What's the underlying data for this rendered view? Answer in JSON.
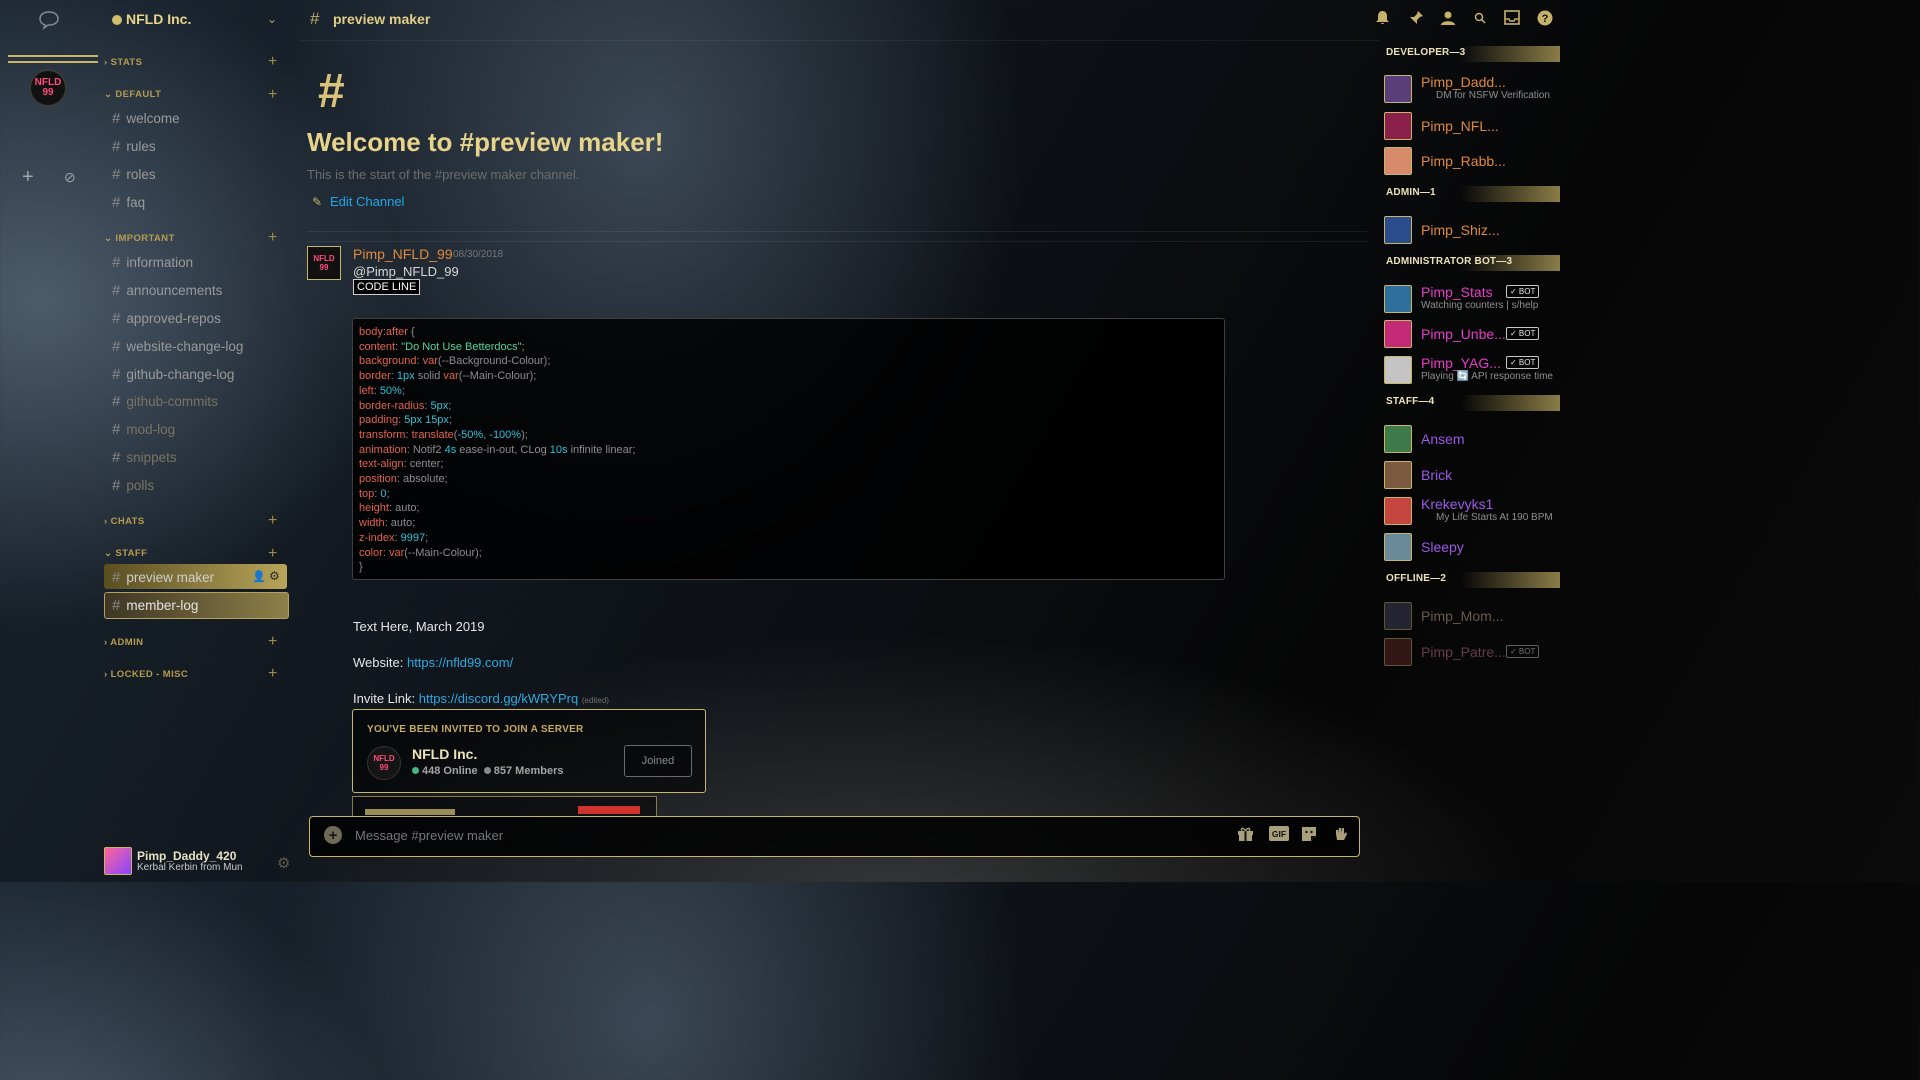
{
  "rail": {
    "home_icon": "chat-bubble-icon",
    "server_abbrev": "NFLD 99",
    "add_glyph": "+",
    "explore_glyph": "⊘"
  },
  "server": {
    "name": "NFLD Inc."
  },
  "sidebar": {
    "categories": [
      "STATS",
      "DEFAULT",
      "IMPORTANT",
      "CHATS",
      "STAFF",
      "ADMIN",
      "LOCKED - MISC"
    ],
    "default_channels": [
      "welcome",
      "rules",
      "roles",
      "faq"
    ],
    "important_channels": [
      "information",
      "announcements",
      "approved-repos",
      "website-change-log",
      "github-change-log",
      "github-commits",
      "mod-log",
      "snippets",
      "polls"
    ],
    "staff_channels": [
      "preview maker",
      "member-log"
    ]
  },
  "user_panel": {
    "username": "Pimp_Daddy_420",
    "status": "Kerbal Kerbin from Mun"
  },
  "header": {
    "channel": "preview maker"
  },
  "welcome": {
    "hash": "#",
    "title": "Welcome to #preview maker!",
    "subtitle": "This is the start of the #preview maker channel.",
    "edit_label": "Edit Channel"
  },
  "message": {
    "author": "Pimp_NFLD_99",
    "timestamp": "08/30/2018",
    "mention": "@Pimp_NFLD_99",
    "code_inline": "CODE LINE",
    "text_here": "Text Here, March 2019",
    "website_label": "Website:",
    "website_url": "https://nfld99.com/",
    "invite_label": "Invite Link:",
    "invite_url": "https://discord.gg/kWRYPrq",
    "edited": "(edited)"
  },
  "codeblock": [
    [
      [
        "kw",
        "body"
      ],
      [
        "plain",
        ":"
      ],
      [
        "kw",
        "after"
      ],
      [
        "brace",
        " {"
      ]
    ],
    [
      [
        "kw",
        "content"
      ],
      [
        "plain",
        ": "
      ],
      [
        "str",
        "\"Do Not Use Betterdocs\""
      ],
      [
        "plain",
        ";"
      ]
    ],
    [
      [
        "kw",
        "background"
      ],
      [
        "plain",
        ": "
      ],
      [
        "kw",
        "var"
      ],
      [
        "plain",
        "(--Background-Colour);"
      ]
    ],
    [
      [
        "kw",
        "border"
      ],
      [
        "plain",
        ": "
      ],
      [
        "num",
        "1px"
      ],
      [
        "plain",
        " solid "
      ],
      [
        "kw",
        "var"
      ],
      [
        "plain",
        "(--Main-Colour);"
      ]
    ],
    [
      [
        "kw",
        "left"
      ],
      [
        "plain",
        ": "
      ],
      [
        "num",
        "50%"
      ],
      [
        "plain",
        ";"
      ]
    ],
    [
      [
        "kw",
        "border-radius"
      ],
      [
        "plain",
        ": "
      ],
      [
        "num",
        "5px"
      ],
      [
        "plain",
        ";"
      ]
    ],
    [
      [
        "kw",
        "padding"
      ],
      [
        "plain",
        ": "
      ],
      [
        "num",
        "5px 15px"
      ],
      [
        "plain",
        ";"
      ]
    ],
    [
      [
        "kw",
        "transform"
      ],
      [
        "plain",
        ": "
      ],
      [
        "kw",
        "translate"
      ],
      [
        "plain",
        "("
      ],
      [
        "num",
        "-50%"
      ],
      [
        "plain",
        ", "
      ],
      [
        "num",
        "-100%"
      ],
      [
        "plain",
        ");"
      ]
    ],
    [
      [
        "kw",
        "animation"
      ],
      [
        "plain",
        ": Notif2 "
      ],
      [
        "num",
        "4s"
      ],
      [
        "plain",
        " ease-in-out, CLog "
      ],
      [
        "num",
        "10s"
      ],
      [
        "plain",
        " infinite linear;"
      ]
    ],
    [
      [
        "kw",
        "text-align"
      ],
      [
        "plain",
        ": center;"
      ]
    ],
    [
      [
        "kw",
        "position"
      ],
      [
        "plain",
        ": absolute;"
      ]
    ],
    [
      [
        "kw",
        "top"
      ],
      [
        "plain",
        ": "
      ],
      [
        "num",
        "0"
      ],
      [
        "plain",
        ";"
      ]
    ],
    [
      [
        "kw",
        "height"
      ],
      [
        "plain",
        ": auto;"
      ]
    ],
    [
      [
        "kw",
        "width"
      ],
      [
        "plain",
        ": auto;"
      ]
    ],
    [
      [
        "kw",
        "z-index"
      ],
      [
        "plain",
        ": "
      ],
      [
        "num",
        "9997"
      ],
      [
        "plain",
        ";"
      ]
    ],
    [
      [
        "kw",
        "color"
      ],
      [
        "plain",
        ": "
      ],
      [
        "kw",
        "var"
      ],
      [
        "plain",
        "(--Main-Colour);"
      ]
    ],
    [
      [
        "brace",
        "}"
      ]
    ]
  ],
  "invite": {
    "heading": "YOU'VE BEEN INVITED TO JOIN A SERVER",
    "server": "NFLD Inc.",
    "online": "448 Online",
    "members": "857 Members",
    "button": "Joined",
    "online_color": "#43b581",
    "members_color": "#8a8a8a"
  },
  "composer": {
    "placeholder": "Message #preview maker"
  },
  "members": {
    "roles": [
      {
        "name": "DEVELOPER—3",
        "members": [
          {
            "name": "Pimp_Dadd...",
            "sub": "DM for NSFW Verification",
            "color": "#e0893c",
            "bot": false,
            "avatar": "#5a3f7a"
          },
          {
            "name": "Pimp_NFL...",
            "sub": "",
            "color": "#e0893c",
            "bot": false,
            "avatar": "#8a1f4a"
          },
          {
            "name": "Pimp_Rabb...",
            "sub": "",
            "color": "#e0893c",
            "bot": false,
            "avatar": "#d68a6a"
          }
        ]
      },
      {
        "name": "ADMIN—1",
        "members": [
          {
            "name": "Pimp_Shiz...",
            "sub": "",
            "color": "#e0893c",
            "bot": false,
            "avatar": "#2b4c8a"
          }
        ]
      },
      {
        "name": "ADMINISTRATOR BOT—3",
        "members": [
          {
            "name": "Pimp_Stats",
            "sub": "Watching counters | s/help",
            "color": "#e83bc8",
            "bot": true,
            "avatar": "#2f6f9c"
          },
          {
            "name": "Pimp_Unbe...",
            "sub": "",
            "color": "#e83bc8",
            "bot": true,
            "avatar": "#c42a78"
          },
          {
            "name": "Pimp_YAG...",
            "sub": "Playing 🔄 API response time",
            "color": "#e83bc8",
            "bot": true,
            "avatar": "#c4c4c4"
          }
        ]
      },
      {
        "name": "STAFF—4",
        "members": [
          {
            "name": "Ansem",
            "sub": "",
            "color": "#9b59e6",
            "bot": false,
            "avatar": "#3f7a4a"
          },
          {
            "name": "Brick",
            "sub": "",
            "color": "#9b59e6",
            "bot": false,
            "avatar": "#7a5a3f"
          },
          {
            "name": "Krekevyks1",
            "sub": "My Life Starts At 190 BPM",
            "color": "#9b59e6",
            "bot": false,
            "avatar": "#c4463f"
          },
          {
            "name": "Sleepy",
            "sub": "",
            "color": "#9b59e6",
            "bot": false,
            "avatar": "#6a8a9a"
          }
        ]
      },
      {
        "name": "OFFLINE—2",
        "members": [
          {
            "name": "Pimp_Mom...",
            "sub": "",
            "color": "#6a5a48",
            "bot": false,
            "avatar": "#4a4a6a"
          },
          {
            "name": "Pimp_Patre...",
            "sub": "",
            "color": "#6a3a4a",
            "bot": true,
            "avatar": "#6a2a2a"
          }
        ]
      }
    ],
    "bot_label": "BOT"
  }
}
